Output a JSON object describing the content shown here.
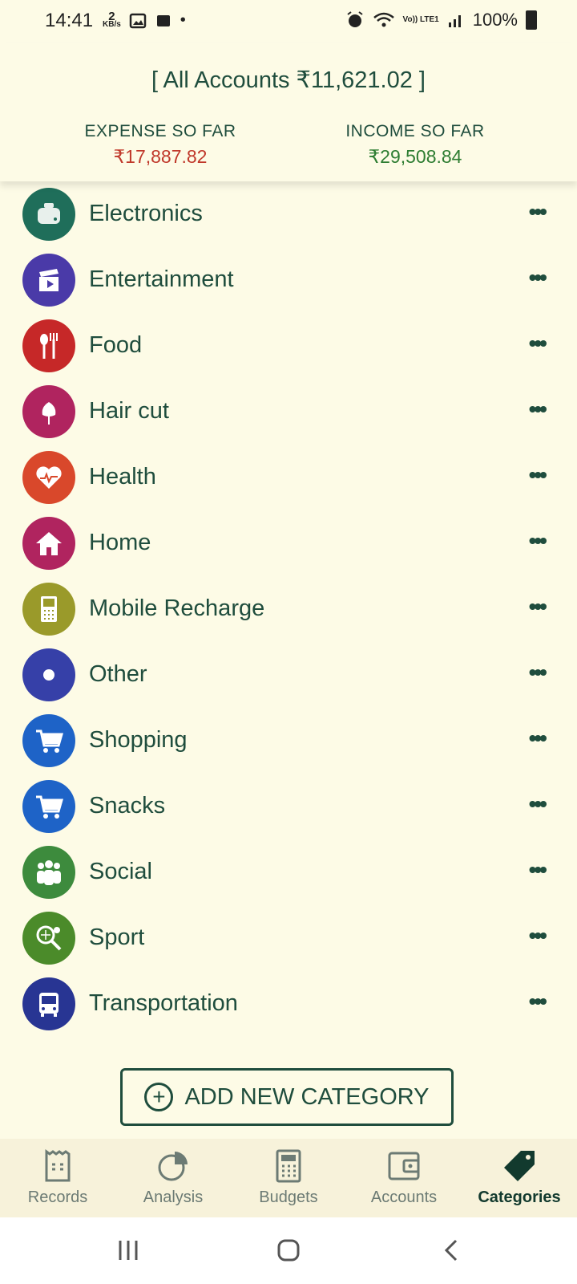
{
  "status_bar": {
    "time": "14:41",
    "data_rate_value": "2",
    "data_rate_unit": "KB/s",
    "battery": "100%",
    "network": "Vo)) LTE1"
  },
  "header": {
    "accounts_title": "[ All Accounts ₹11,621.02 ]",
    "expense_label": "EXPENSE SO FAR",
    "expense_value": "₹17,887.82",
    "income_label": "INCOME SO FAR",
    "income_value": "₹29,508.84"
  },
  "categories": [
    {
      "name": "Electronics",
      "color": "#1f6e5a",
      "icon": "toaster-icon"
    },
    {
      "name": "Entertainment",
      "color": "#4a3aa8",
      "icon": "clapperboard-icon"
    },
    {
      "name": "Food",
      "color": "#c62828",
      "icon": "fork-spoon-icon"
    },
    {
      "name": "Hair cut",
      "color": "#b0245f",
      "icon": "tulip-icon"
    },
    {
      "name": "Health",
      "color": "#d9482b",
      "icon": "heart-pulse-icon"
    },
    {
      "name": "Home",
      "color": "#b0245f",
      "icon": "house-icon"
    },
    {
      "name": "Mobile Recharge",
      "color": "#9a9a2a",
      "icon": "phone-icon"
    },
    {
      "name": "Other",
      "color": "#3640a8",
      "icon": "circle-dot-icon"
    },
    {
      "name": "Shopping",
      "color": "#1e63c7",
      "icon": "cart-icon"
    },
    {
      "name": "Snacks",
      "color": "#1e63c7",
      "icon": "cart-icon"
    },
    {
      "name": "Social",
      "color": "#3d8b3d",
      "icon": "people-icon"
    },
    {
      "name": "Sport",
      "color": "#4b8b2a",
      "icon": "tennis-icon"
    },
    {
      "name": "Transportation",
      "color": "#283593",
      "icon": "bus-icon"
    }
  ],
  "add_button_label": "ADD NEW CATEGORY",
  "nav": {
    "records": "Records",
    "analysis": "Analysis",
    "budgets": "Budgets",
    "accounts": "Accounts",
    "categories": "Categories"
  },
  "menu_glyph": "•••"
}
